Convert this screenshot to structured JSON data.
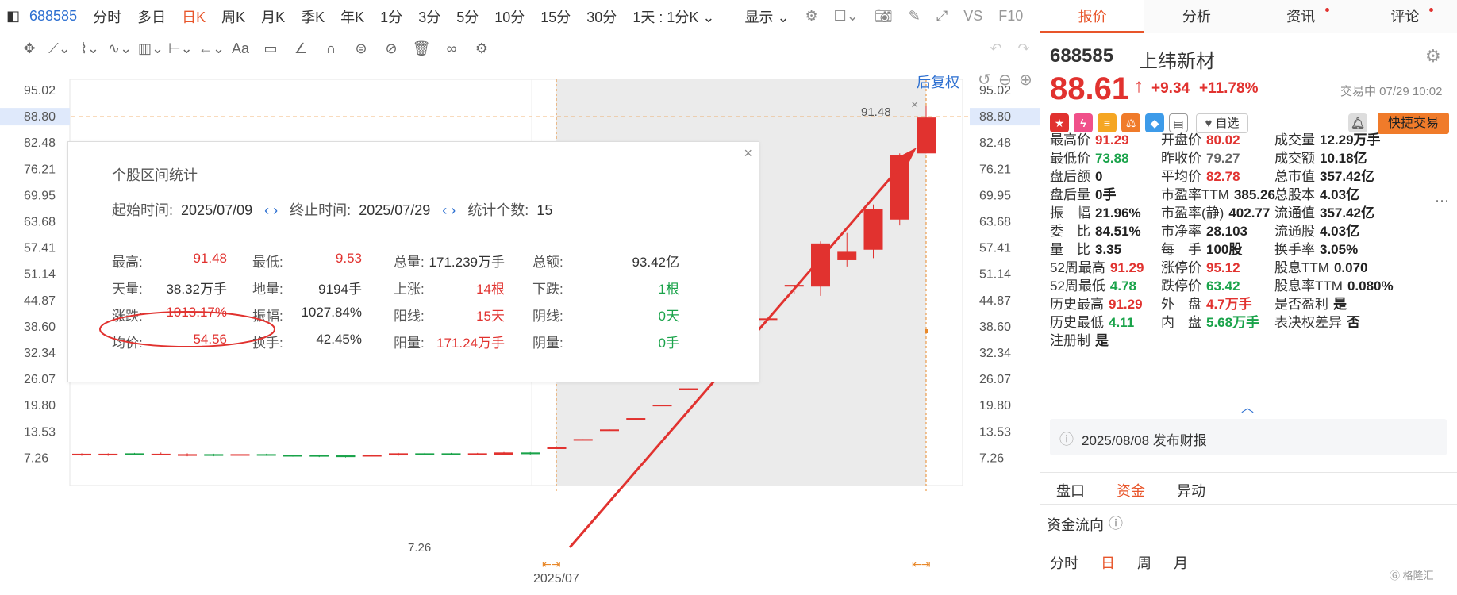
{
  "toolbar": {
    "code": "688585",
    "periods": [
      "分时",
      "多日",
      "日K",
      "周K",
      "月K",
      "季K",
      "年K",
      "1分",
      "3分",
      "5分",
      "10分",
      "15分",
      "30分"
    ],
    "active_period": "日K",
    "range": "1天 : 1分K",
    "display": "显示",
    "vs": "VS",
    "f10": "F10"
  },
  "chart": {
    "fq_label": "后复权",
    "y_ticks": [
      "95.02",
      "88.80",
      "82.48",
      "76.21",
      "69.95",
      "63.68",
      "57.41",
      "51.14",
      "44.87",
      "38.60",
      "32.34",
      "26.07",
      "19.80",
      "13.53",
      "7.26"
    ],
    "high_marker": "91.48",
    "low_marker": "7.26",
    "x_label": "2025/07",
    "current_price_line": "88.80",
    "colors": {
      "up": "#e1322f",
      "down": "#1aa34a",
      "accent": "#e8552a"
    }
  },
  "stats": {
    "title": "个股区间统计",
    "start_label": "起始时间:",
    "start_value": "2025/07/09",
    "end_label": "终止时间:",
    "end_value": "2025/07/29",
    "count_label": "统计个数:",
    "count_value": "15",
    "rows": [
      [
        {
          "k": "最高:",
          "v": "91.48",
          "c": "red"
        },
        {
          "k": "最低:",
          "v": "9.53",
          "c": "red"
        },
        {
          "k": "总量:",
          "v": "171.239万手",
          "c": ""
        },
        {
          "k": "总额:",
          "v": "93.42亿",
          "c": ""
        }
      ],
      [
        {
          "k": "天量:",
          "v": "38.32万手",
          "c": ""
        },
        {
          "k": "地量:",
          "v": "9194手",
          "c": ""
        },
        {
          "k": "上涨:",
          "v": "14根",
          "c": "red"
        },
        {
          "k": "下跌:",
          "v": "1根",
          "c": "green"
        }
      ],
      [
        {
          "k": "涨跌:",
          "v": "1013.17%",
          "c": "red"
        },
        {
          "k": "振幅:",
          "v": "1027.84%",
          "c": ""
        },
        {
          "k": "阳线:",
          "v": "15天",
          "c": "red"
        },
        {
          "k": "阴线:",
          "v": "0天",
          "c": "green"
        }
      ],
      [
        {
          "k": "均价:",
          "v": "54.56",
          "c": "red"
        },
        {
          "k": "换手:",
          "v": "42.45%",
          "c": ""
        },
        {
          "k": "阳量:",
          "v": "171.24万手",
          "c": "red"
        },
        {
          "k": "阴量:",
          "v": "0手",
          "c": "green"
        }
      ]
    ]
  },
  "quote": {
    "tabs": [
      "报价",
      "分析",
      "资讯",
      "评论"
    ],
    "code": "688585",
    "name": "上纬新材",
    "price": "88.61",
    "change": "+9.34",
    "change_pct": "+11.78%",
    "status": "交易中 07/29 10:02",
    "watch": "自选",
    "fast_trade": "快捷交易",
    "fields": [
      [
        {
          "k": "最高价",
          "v": "91.29",
          "c": "red"
        },
        {
          "k": "开盘价",
          "v": "80.02",
          "c": "red"
        },
        {
          "k": "成交量",
          "v": "12.29万手",
          "c": ""
        }
      ],
      [
        {
          "k": "最低价",
          "v": "73.88",
          "c": "green"
        },
        {
          "k": "昨收价",
          "v": "79.27",
          "c": "gray"
        },
        {
          "k": "成交额",
          "v": "10.18亿",
          "c": ""
        }
      ],
      [
        {
          "k": "盘后额",
          "v": "0",
          "c": ""
        },
        {
          "k": "平均价",
          "v": "82.78",
          "c": "red"
        },
        {
          "k": "总市值",
          "v": "357.42亿",
          "c": ""
        }
      ],
      [
        {
          "k": "盘后量",
          "v": "0手",
          "c": ""
        },
        {
          "k": "市盈率TTM",
          "v": "385.26",
          "c": ""
        },
        {
          "k": "总股本",
          "v": "4.03亿",
          "c": ""
        }
      ],
      [
        {
          "k": "振　幅",
          "v": "21.96%",
          "c": ""
        },
        {
          "k": "市盈率(静)",
          "v": "402.77",
          "c": ""
        },
        {
          "k": "流通值",
          "v": "357.42亿",
          "c": ""
        }
      ],
      [
        {
          "k": "委　比",
          "v": "84.51%",
          "c": ""
        },
        {
          "k": "市净率",
          "v": "28.103",
          "c": ""
        },
        {
          "k": "流通股",
          "v": "4.03亿",
          "c": ""
        }
      ],
      [
        {
          "k": "量　比",
          "v": "3.35",
          "c": ""
        },
        {
          "k": "每　手",
          "v": "100股",
          "c": ""
        },
        {
          "k": "换手率",
          "v": "3.05%",
          "c": ""
        }
      ],
      [
        {
          "k": "52周最高",
          "v": "91.29",
          "c": "red"
        },
        {
          "k": "涨停价",
          "v": "95.12",
          "c": "red"
        },
        {
          "k": "股息TTM",
          "v": "0.070",
          "c": ""
        }
      ],
      [
        {
          "k": "52周最低",
          "v": "4.78",
          "c": "green"
        },
        {
          "k": "跌停价",
          "v": "63.42",
          "c": "green"
        },
        {
          "k": "股息率TTM",
          "v": "0.080%",
          "c": ""
        }
      ],
      [
        {
          "k": "历史最高",
          "v": "91.29",
          "c": "red"
        },
        {
          "k": "外　盘",
          "v": "4.7万手",
          "c": "red"
        },
        {
          "k": "是否盈利",
          "v": "是",
          "c": ""
        }
      ],
      [
        {
          "k": "历史最低",
          "v": "4.11",
          "c": "green"
        },
        {
          "k": "内　盘",
          "v": "5.68万手",
          "c": "green"
        },
        {
          "k": "表决权差异",
          "v": "否",
          "c": ""
        }
      ],
      [
        {
          "k": "注册制",
          "v": "是",
          "c": ""
        }
      ]
    ],
    "notice": "2025/08/08  发布财报",
    "sub_tabs": [
      "盘口",
      "资金",
      "异动"
    ],
    "flow_title": "资金流向",
    "flow_tabs": [
      "分时",
      "日",
      "周",
      "月"
    ],
    "watermark": "格隆汇"
  },
  "candles": [
    {
      "o": 7.9,
      "c": 8.3,
      "h": 8.4,
      "l": 7.8,
      "up": true
    },
    {
      "o": 8.3,
      "c": 7.9,
      "h": 8.4,
      "l": 7.8,
      "up": true
    },
    {
      "o": 8.0,
      "c": 8.4,
      "h": 8.5,
      "l": 7.9,
      "up": false
    },
    {
      "o": 8.3,
      "c": 8.2,
      "h": 8.6,
      "l": 8.0,
      "up": true
    },
    {
      "o": 8.2,
      "c": 7.8,
      "h": 8.4,
      "l": 7.7,
      "up": true
    },
    {
      "o": 7.8,
      "c": 8.2,
      "h": 8.3,
      "l": 7.7,
      "up": false
    },
    {
      "o": 8.2,
      "c": 8.1,
      "h": 8.4,
      "l": 8.0,
      "up": true
    },
    {
      "o": 7.9,
      "c": 8.2,
      "h": 8.3,
      "l": 7.8,
      "up": false
    },
    {
      "o": 7.7,
      "c": 8.0,
      "h": 8.1,
      "l": 7.6,
      "up": false
    },
    {
      "o": 7.6,
      "c": 8.0,
      "h": 8.1,
      "l": 7.5,
      "up": false
    },
    {
      "o": 7.5,
      "c": 7.9,
      "h": 8.0,
      "l": 7.4,
      "up": false
    },
    {
      "o": 7.8,
      "c": 8.0,
      "h": 8.1,
      "l": 7.7,
      "up": true
    },
    {
      "o": 7.9,
      "c": 8.4,
      "h": 8.5,
      "l": 7.8,
      "up": true
    },
    {
      "o": 8.0,
      "c": 8.4,
      "h": 8.5,
      "l": 7.9,
      "up": false
    },
    {
      "o": 8.3,
      "c": 8.4,
      "h": 8.5,
      "l": 8.2,
      "up": false
    },
    {
      "o": 8.3,
      "c": 8.4,
      "h": 8.5,
      "l": 8.2,
      "up": true
    },
    {
      "o": 8.0,
      "c": 8.6,
      "h": 8.7,
      "l": 7.9,
      "up": true
    },
    {
      "o": 8.2,
      "c": 8.6,
      "h": 8.7,
      "l": 8.1,
      "up": false
    },
    {
      "o": 9.53,
      "c": 9.8,
      "h": 9.9,
      "l": 9.53,
      "up": true
    },
    {
      "o": 11.6,
      "c": 11.8,
      "h": 11.8,
      "l": 11.6,
      "up": true
    },
    {
      "o": 13.9,
      "c": 14.1,
      "h": 14.1,
      "l": 13.9,
      "up": true
    },
    {
      "o": 16.6,
      "c": 16.8,
      "h": 16.8,
      "l": 16.6,
      "up": true
    },
    {
      "o": 19.8,
      "c": 20.0,
      "h": 20.0,
      "l": 19.8,
      "up": true
    },
    {
      "o": 23.7,
      "c": 23.9,
      "h": 23.9,
      "l": 23.7,
      "up": true
    },
    {
      "o": 28.3,
      "c": 28.5,
      "h": 28.5,
      "l": 28.3,
      "up": true
    },
    {
      "o": 33.8,
      "c": 34.0,
      "h": 34.0,
      "l": 33.8,
      "up": true
    },
    {
      "o": 40.4,
      "c": 40.6,
      "h": 40.6,
      "l": 40.4,
      "up": true
    },
    {
      "o": 48.2,
      "c": 48.6,
      "h": 48.6,
      "l": 46.5,
      "up": true
    },
    {
      "o": 48.2,
      "c": 58.5,
      "h": 59.0,
      "l": 46.0,
      "up": true
    },
    {
      "o": 54.5,
      "c": 56.5,
      "h": 61.0,
      "l": 53.0,
      "up": true
    },
    {
      "o": 57.0,
      "c": 66.8,
      "h": 67.8,
      "l": 55.0,
      "up": true
    },
    {
      "o": 64.2,
      "c": 79.6,
      "h": 80.0,
      "l": 62.8,
      "up": true
    },
    {
      "o": 80.0,
      "c": 88.6,
      "h": 91.3,
      "l": 80.0,
      "up": true
    }
  ]
}
